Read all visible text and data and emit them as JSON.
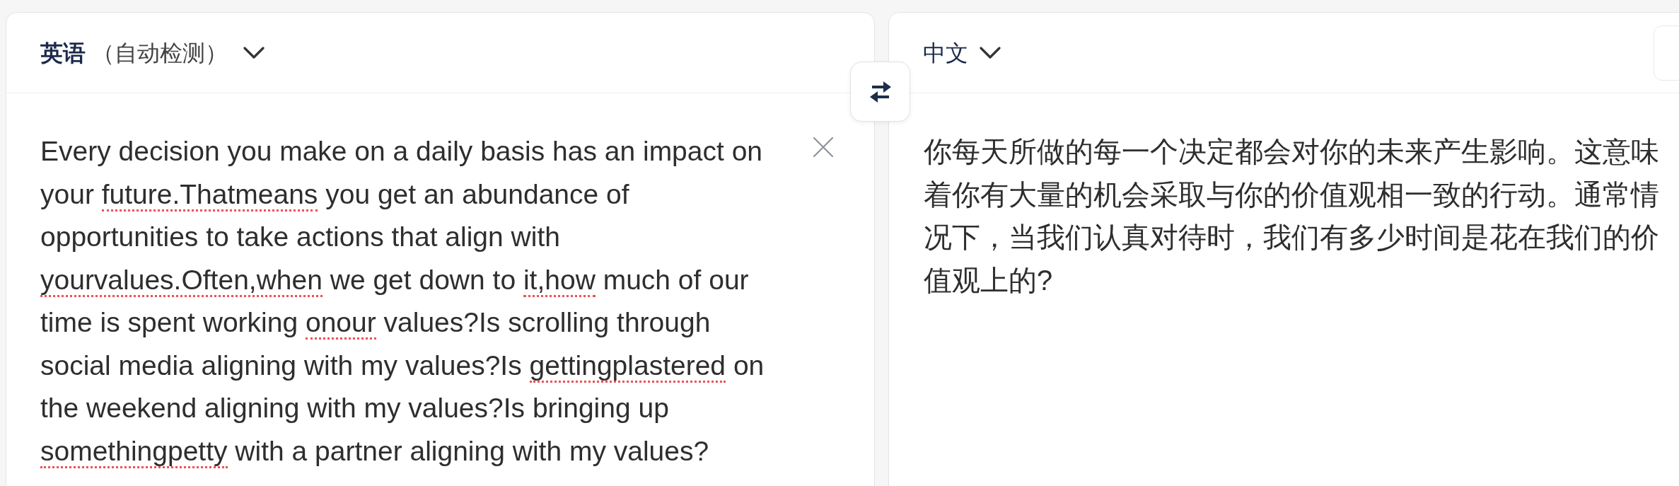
{
  "source_panel": {
    "language_label": "**英语** （自动检测）",
    "text_segments": [
      {
        "text": "Every decision you make on a daily basis has an impact on your ",
        "misspelled": false
      },
      {
        "text": "future.Thatmeans",
        "misspelled": true
      },
      {
        "text": " you get an abundance of opportunities to take actions that align with ",
        "misspelled": false
      },
      {
        "text": "yourvalues.Often,when",
        "misspelled": true
      },
      {
        "text": " we get down to ",
        "misspelled": false
      },
      {
        "text": "it,how",
        "misspelled": true
      },
      {
        "text": " much of our time is spent working ",
        "misspelled": false
      },
      {
        "text": "onour",
        "misspelled": true
      },
      {
        "text": " values?Is scrolling through social media aligning with my values?Is ",
        "misspelled": false
      },
      {
        "text": "gettingplastered",
        "misspelled": true
      },
      {
        "text": " on the weekend aligning with my values?Is bringing up ",
        "misspelled": false
      },
      {
        "text": "somethingpetty",
        "misspelled": true
      },
      {
        "text": " with a partner aligning with my values?",
        "misspelled": false
      }
    ]
  },
  "target_panel": {
    "language": "中文",
    "translation": "你每天所做的每一个决定都会对你的未来产生影响。这意味着你有大量的机会采取与你的价值观相一致的行动。通常情况下，当我们认真对待时，我们有多少时间是花在我们的价值观上的?"
  }
}
